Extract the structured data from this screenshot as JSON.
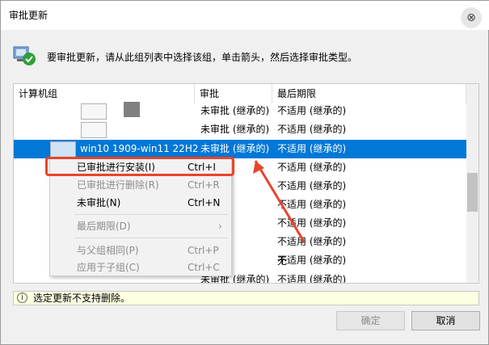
{
  "window": {
    "title": "审批更新",
    "close_glyph": "⊗"
  },
  "instruction": "要审批更新，请从此组列表中选择该组，单击箭头，然后选择审批类型。",
  "columns": [
    "计算机组",
    "审批",
    "最后期限"
  ],
  "rows": [
    {
      "group": "",
      "approval": "未审批 (继承的)",
      "deadline": "不适用 (继承的)"
    },
    {
      "group": "",
      "approval": "未审批 (继承的)",
      "deadline": "不适用 (继承的)"
    },
    {
      "group": "win10 1909-win11 22H2",
      "approval": "未审批 (继承的)",
      "deadline": "不适用 (继承的)",
      "selected": true
    },
    {
      "group": "",
      "approval": "",
      "deadline": "不适用 (继承的)"
    },
    {
      "group": "",
      "approval": "",
      "deadline": "不适用 (继承的)"
    },
    {
      "group": "",
      "approval": "",
      "deadline": "不适用 (继承的)"
    },
    {
      "group": "",
      "approval": "",
      "deadline": "不适用 (继承的)"
    },
    {
      "group": "",
      "approval": "",
      "deadline": "不适用 (继承的)"
    },
    {
      "group": "",
      "approval": "",
      "deadline": "不适用 (继承的)"
    },
    {
      "group": "",
      "approval": "",
      "deadline": "无"
    },
    {
      "group": "",
      "approval": "未审批 (继承的)",
      "deadline": "不适用 (继承的)"
    }
  ],
  "context_menu": [
    {
      "label": "已审批进行安装(I)",
      "shortcut": "Ctrl+I",
      "disabled": false
    },
    {
      "label": "已审批进行删除(R)",
      "shortcut": "Ctrl+R",
      "disabled": true
    },
    {
      "label": "未审批(N)",
      "shortcut": "Ctrl+N",
      "disabled": false
    },
    {
      "label": "最后期限(D)",
      "shortcut": "›",
      "disabled": true
    },
    {
      "label": "与父组相同(P)",
      "shortcut": "Ctrl+P",
      "disabled": true
    },
    {
      "label": "应用于子组(C)",
      "shortcut": "Ctrl+C",
      "disabled": true
    }
  ],
  "status": {
    "icon": "info-icon",
    "text": "选定更新不支持删除。"
  },
  "buttons": {
    "ok": "确定",
    "cancel": "取消"
  },
  "colors": {
    "selection": "#0078d7",
    "annotation": "#e8452c"
  }
}
